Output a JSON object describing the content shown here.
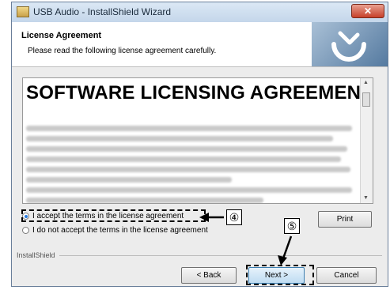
{
  "window": {
    "title": "USB Audio - InstallShield Wizard",
    "close_label": "✕"
  },
  "header": {
    "title": "License Agreement",
    "subtitle": "Please read the following license agreement carefully."
  },
  "license": {
    "title": "SOFTWARE LICENSING AGREEMENT"
  },
  "options": {
    "accept_label": "I accept the terms in the license agreement",
    "decline_label": "I do not accept the terms in the license agreement",
    "selected": "accept"
  },
  "buttons": {
    "print": "Print",
    "back": "< Back",
    "next": "Next >",
    "cancel": "Cancel"
  },
  "footer": {
    "brand": "InstallShield"
  },
  "callouts": {
    "accept": "④",
    "next": "⑤"
  },
  "icons": {
    "app": "installer-icon",
    "logo": "installshield-logo-icon",
    "close": "close-icon"
  }
}
